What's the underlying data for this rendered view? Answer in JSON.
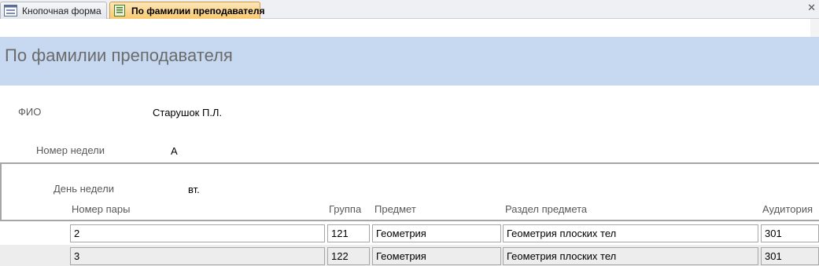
{
  "tabs": [
    {
      "label": "Кнопочная форма",
      "icon": "form-icon"
    },
    {
      "label": "По фамилии преподавателя",
      "icon": "report-icon"
    }
  ],
  "form": {
    "title": "По фамилии преподавателя",
    "fio_label": "ФИО",
    "fio_value": "Старушок П.Л.",
    "week_label": "Номер недели",
    "week_value": "А",
    "day_label": "День недели",
    "day_value": "вт."
  },
  "table": {
    "headers": {
      "pair": "Номер пары",
      "group": "Группа",
      "subject": "Предмет",
      "section": "Раздел предмета",
      "room": "Аудитория"
    },
    "rows": [
      {
        "pair": "2",
        "group": "121",
        "subject": "Геометрия",
        "section": "Геометрия плоских тел",
        "room": "301"
      },
      {
        "pair": "3",
        "group": "122",
        "subject": "Геометрия",
        "section": "Геометрия плоских тел",
        "room": "301"
      }
    ]
  },
  "colors": {
    "header_band": "#c6d9f1",
    "active_tab": "#f9c970"
  }
}
